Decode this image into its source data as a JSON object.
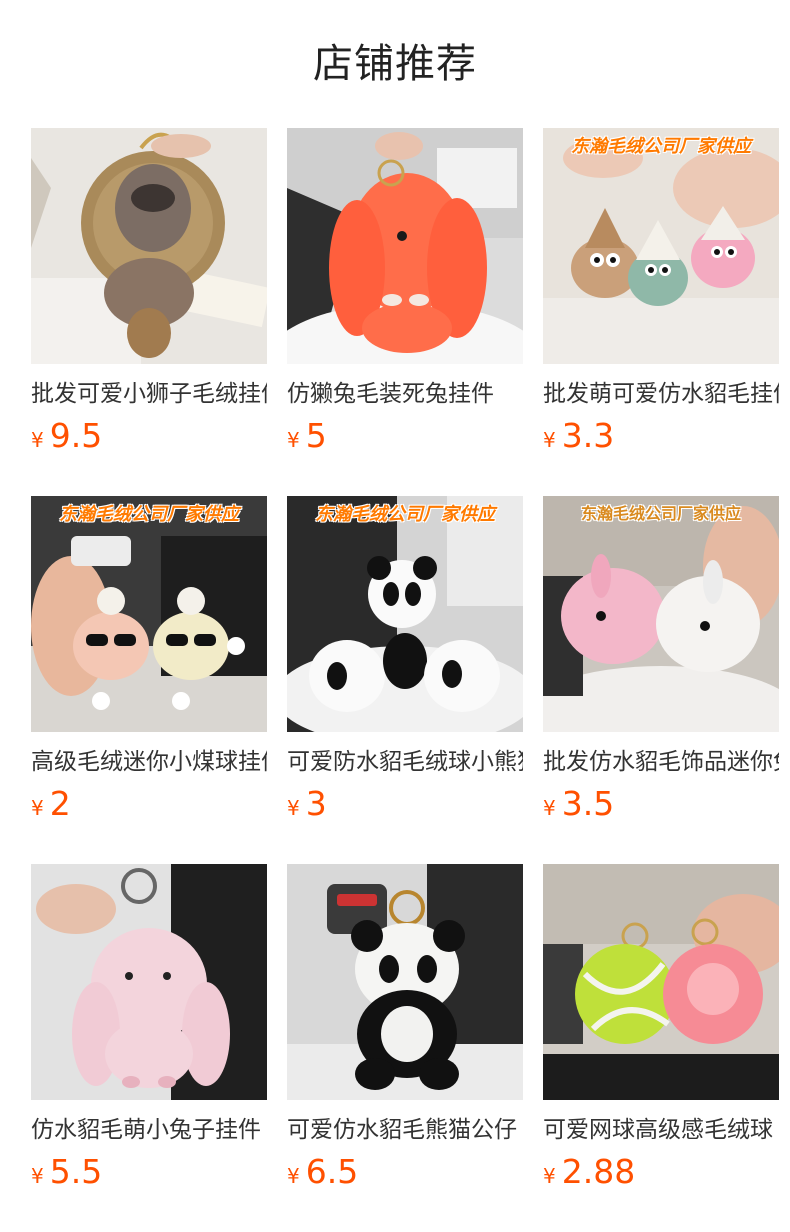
{
  "page": {
    "title": "店铺推荐"
  },
  "currency_symbol": "¥",
  "products": [
    {
      "name": "批发可爱小狮子毛绒挂件",
      "price": "9.5",
      "image": "fluffy-lion-keychain",
      "banner": ""
    },
    {
      "name": "仿獭兔毛装死兔挂件",
      "price": "5",
      "image": "orange-bunny-keychain",
      "banner": ""
    },
    {
      "name": "批发萌可爱仿水貂毛挂件",
      "price": "3.3",
      "image": "knit-hat-pom-keychains",
      "banner": "东瀚毛绒公司厂家供应"
    },
    {
      "name": "高级毛绒迷你小煤球挂件",
      "price": "2",
      "image": "sunglasses-pom-keychains",
      "banner": "东瀚毛绒公司厂家供应"
    },
    {
      "name": "可爱防水貂毛绒球小熊猫",
      "price": "3",
      "image": "panda-pom-keychains",
      "banner": "东瀚毛绒公司厂家供应"
    },
    {
      "name": "批发仿水貂毛饰品迷你兔",
      "price": "3.5",
      "image": "pink-white-bunny-balls",
      "banner": "东瀚毛绒公司厂家供应"
    },
    {
      "name": "仿水貂毛萌小兔子挂件",
      "price": "5.5",
      "image": "pink-bunny-keychain",
      "banner": ""
    },
    {
      "name": "可爱仿水貂毛熊猫公仔",
      "price": "6.5",
      "image": "panda-doll-keychain",
      "banner": ""
    },
    {
      "name": "可爱网球高级感毛绒球",
      "price": "2.88",
      "image": "tennis-ball-pom-keychains",
      "banner": ""
    }
  ],
  "colors": {
    "price": "#ff5000",
    "banner": "#ff7a00"
  }
}
